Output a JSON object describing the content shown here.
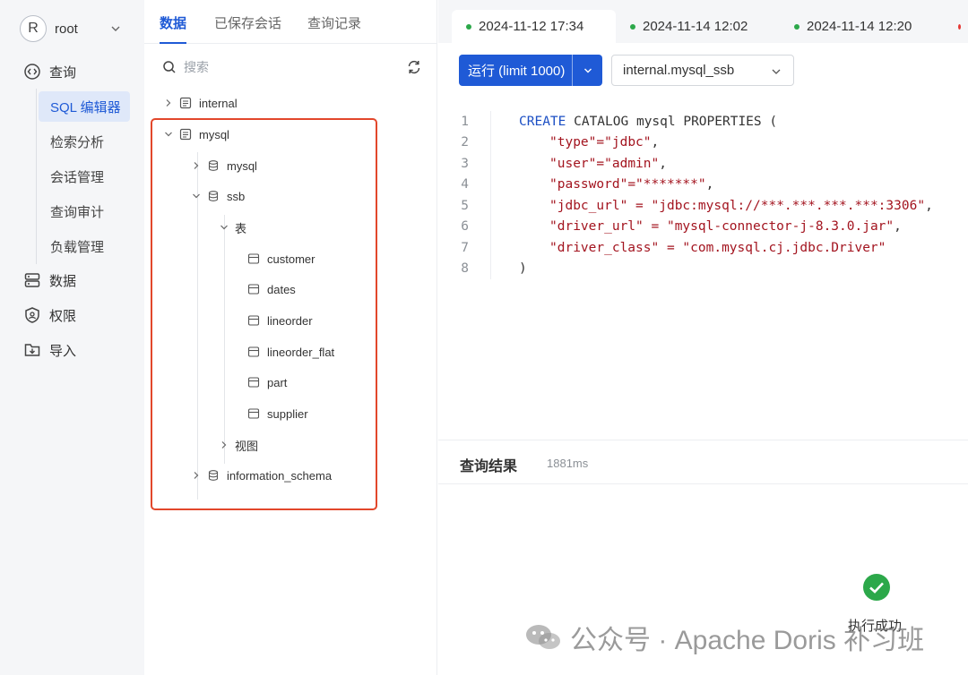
{
  "user": {
    "initial": "R",
    "name": "root"
  },
  "nav": {
    "query": "查询",
    "sub_items": [
      "SQL 编辑器",
      "检索分析",
      "会话管理",
      "查询审计",
      "负载管理"
    ],
    "data": "数据",
    "permissions": "权限",
    "import": "导入"
  },
  "tree_panel": {
    "tabs": [
      "数据",
      "已保存会话",
      "查询记录"
    ],
    "search_placeholder": "搜索",
    "catalogs": {
      "internal": "internal",
      "mysql": "mysql"
    },
    "databases": {
      "mysql": "mysql",
      "ssb": "ssb",
      "information_schema": "information_schema"
    },
    "tables_group": "表",
    "views_group": "视图",
    "tables": [
      "customer",
      "dates",
      "lineorder",
      "lineorder_flat",
      "part",
      "supplier"
    ]
  },
  "editor": {
    "tabs": [
      "2024-11-12 17:34",
      "2024-11-14 12:02",
      "2024-11-14 12:20"
    ],
    "run_label": "运行 (limit 1000)",
    "db_selected": "internal.mysql_ssb",
    "line_numbers": [
      "1",
      "2",
      "3",
      "4",
      "5",
      "6",
      "7",
      "8"
    ],
    "code": {
      "l1_kw": "CREATE",
      "l1_rest": " CATALOG mysql PROPERTIES (",
      "l2_k": "\"type\"",
      "l2_v": "\"jdbc\"",
      "l3_k": "\"user\"",
      "l3_v": "\"admin\"",
      "l4_k": "\"password\"",
      "l4_v": "\"*******\"",
      "l5_k": "\"jdbc_url\"",
      "l5_v": "\"jdbc:mysql://***.***.***.***:3306\"",
      "l6_k": "\"driver_url\"",
      "l6_v": "\"mysql-connector-j-8.3.0.jar\"",
      "l7_k": "\"driver_class\"",
      "l7_v": "\"com.mysql.cj.jdbc.Driver\"",
      "l8": ")"
    }
  },
  "result": {
    "title": "查询结果",
    "time": "1881ms",
    "status": "执行成功"
  },
  "watermark": "公众号 · Apache Doris 补习班",
  "colors": {
    "accent": "#1f5ad6",
    "success": "#2ca84a",
    "highlight_border": "#e2472b"
  }
}
